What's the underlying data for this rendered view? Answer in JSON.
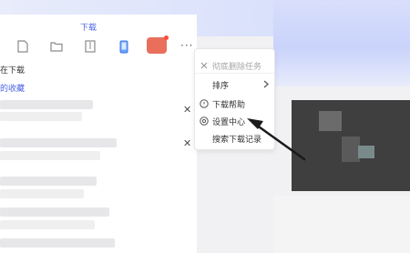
{
  "header": {
    "tab_title": "下载"
  },
  "toolbar": {
    "icons": [
      "file-icon",
      "folder-icon",
      "archive-icon",
      "phone-icon",
      "red-badge-icon",
      "more-icon"
    ],
    "more_label": "···"
  },
  "left_list": {
    "section_labels": [
      "在下载",
      "的收藏"
    ]
  },
  "menu": {
    "items": [
      {
        "label": "彻底删除任务",
        "enabled": false,
        "icon": "close-icon"
      },
      {
        "label": "排序",
        "enabled": true,
        "has_submenu": true
      },
      {
        "label": "下载帮助",
        "enabled": true,
        "icon": "help-icon"
      },
      {
        "label": "设置中心",
        "enabled": true,
        "icon": "gear-icon"
      },
      {
        "label": "搜索下载记录",
        "enabled": true
      }
    ]
  },
  "colors": {
    "accent": "#4a63e7",
    "menu_border": "#e6e6ea",
    "arrow": "#1a1a1a"
  }
}
